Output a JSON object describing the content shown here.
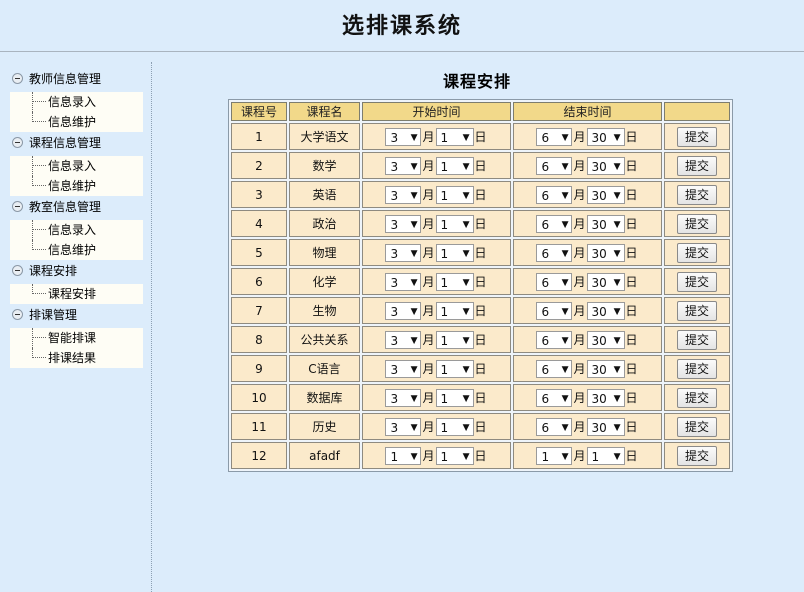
{
  "app": {
    "title": "选排课系统"
  },
  "sidebar": {
    "groups": [
      {
        "label": "教师信息管理",
        "items": [
          "信息录入",
          "信息维护"
        ]
      },
      {
        "label": "课程信息管理",
        "items": [
          "信息录入",
          "信息维护"
        ]
      },
      {
        "label": "教室信息管理",
        "items": [
          "信息录入",
          "信息维护"
        ]
      },
      {
        "label": "课程安排",
        "items": [
          "课程安排"
        ]
      },
      {
        "label": "排课管理",
        "items": [
          "智能排课",
          "排课结果"
        ]
      }
    ]
  },
  "main": {
    "title": "课程安排",
    "columns": [
      "课程号",
      "课程名",
      "开始时间",
      "结束时间",
      ""
    ],
    "month_unit": "月",
    "day_unit": "日",
    "submit_label": "提交",
    "rows": [
      {
        "id": "1",
        "name": "大学语文",
        "start_month": "3",
        "start_day": "1",
        "end_month": "6",
        "end_day": "30"
      },
      {
        "id": "2",
        "name": "数学",
        "start_month": "3",
        "start_day": "1",
        "end_month": "6",
        "end_day": "30"
      },
      {
        "id": "3",
        "name": "英语",
        "start_month": "3",
        "start_day": "1",
        "end_month": "6",
        "end_day": "30"
      },
      {
        "id": "4",
        "name": "政治",
        "start_month": "3",
        "start_day": "1",
        "end_month": "6",
        "end_day": "30"
      },
      {
        "id": "5",
        "name": "物理",
        "start_month": "3",
        "start_day": "1",
        "end_month": "6",
        "end_day": "30"
      },
      {
        "id": "6",
        "name": "化学",
        "start_month": "3",
        "start_day": "1",
        "end_month": "6",
        "end_day": "30"
      },
      {
        "id": "7",
        "name": "生物",
        "start_month": "3",
        "start_day": "1",
        "end_month": "6",
        "end_day": "30"
      },
      {
        "id": "8",
        "name": "公共关系",
        "start_month": "3",
        "start_day": "1",
        "end_month": "6",
        "end_day": "30"
      },
      {
        "id": "9",
        "name": "C语言",
        "start_month": "3",
        "start_day": "1",
        "end_month": "6",
        "end_day": "30"
      },
      {
        "id": "10",
        "name": "数据库",
        "start_month": "3",
        "start_day": "1",
        "end_month": "6",
        "end_day": "30"
      },
      {
        "id": "11",
        "name": "历史",
        "start_month": "3",
        "start_day": "1",
        "end_month": "6",
        "end_day": "30"
      },
      {
        "id": "12",
        "name": "afadf",
        "start_month": "1",
        "start_day": "1",
        "end_month": "1",
        "end_day": "1"
      }
    ]
  },
  "colors": {
    "background": "#dcecfb",
    "header_cell": "#f2d98a",
    "body_cell": "#fbeacb",
    "submenu": "#fefdf5"
  }
}
